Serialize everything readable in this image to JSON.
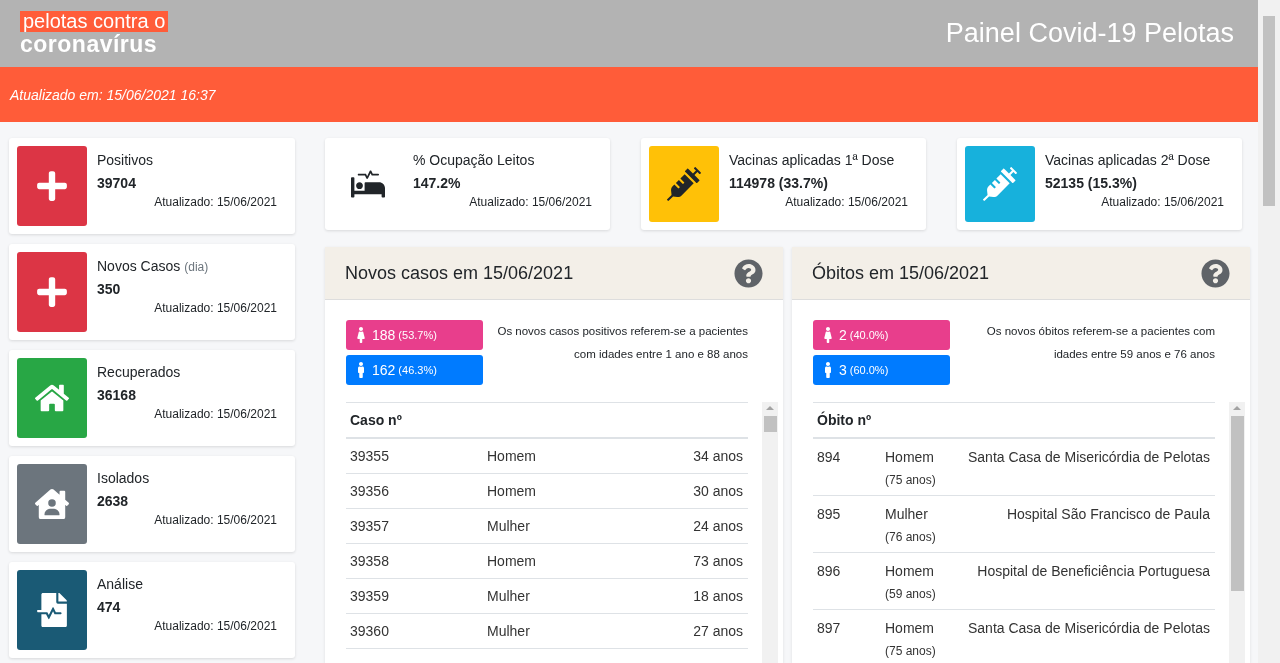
{
  "header": {
    "logo_top": "pelotas contra o",
    "logo_bottom": "coronavírus",
    "title": "Painel Covid-19 Pelotas"
  },
  "update_bar": "Atualizado em: 15/06/2021 16:37",
  "side_cards": [
    {
      "kind": "plus",
      "color": "#dc3545",
      "title": "Positivos",
      "value": "39704",
      "updated": "Atualizado: 15/06/2021"
    },
    {
      "kind": "plus",
      "color": "#dc3545",
      "title": "Novos Casos",
      "note": "(dia)",
      "value": "350",
      "updated": "Atualizado: 15/06/2021"
    },
    {
      "kind": "house",
      "color": "#28a745",
      "title": "Recuperados",
      "value": "36168",
      "updated": "Atualizado: 15/06/2021"
    },
    {
      "kind": "person",
      "color": "#6c757d",
      "title": "Isolados",
      "value": "2638",
      "updated": "Atualizado: 15/06/2021"
    },
    {
      "kind": "document",
      "color": "#1a5a75",
      "title": "Análise",
      "value": "474",
      "updated": "Atualizado: 15/06/2021"
    }
  ],
  "top_cards": [
    {
      "kind": "bed",
      "title": "% Ocupação Leitos",
      "value": "147.2%",
      "updated": "Atualizado: 15/06/2021"
    },
    {
      "kind": "syringe",
      "color": "#ffc107",
      "title": "Vacinas aplicadas 1ª Dose",
      "value": "114978 (33.7%)",
      "updated": "Atualizado: 15/06/2021"
    },
    {
      "kind": "syringe",
      "color": "#17b1dc",
      "title": "Vacinas aplicadas 2ª Dose",
      "value": "52135 (15.3%)",
      "updated": "Atualizado: 15/06/2021"
    }
  ],
  "panels": [
    {
      "kind": "cases",
      "title": "Novos casos em 15/06/2021",
      "female": {
        "count": "188",
        "share": "(53.7%)"
      },
      "male": {
        "count": "162",
        "share": "(46.3%)"
      },
      "description": "Os novos casos positivos referem-se a pacientes com idades entre 1 ano e 88 anos",
      "columns": [
        "Caso nº"
      ],
      "rows": [
        {
          "number": "39355",
          "sex": "Homem",
          "age": "34 anos"
        },
        {
          "number": "39356",
          "sex": "Homem",
          "age": "30 anos"
        },
        {
          "number": "39357",
          "sex": "Mulher",
          "age": "24 anos"
        },
        {
          "number": "39358",
          "sex": "Homem",
          "age": "73 anos"
        },
        {
          "number": "39359",
          "sex": "Mulher",
          "age": "18 anos"
        },
        {
          "number": "39360",
          "sex": "Mulher",
          "age": "27 anos"
        }
      ]
    },
    {
      "kind": "deaths",
      "title": "Óbitos em 15/06/2021",
      "female": {
        "count": "2",
        "share": "(40.0%)"
      },
      "male": {
        "count": "3",
        "share": "(60.0%)"
      },
      "description": "Os novos óbitos referem-se a pacientes com idades entre 59 anos e 76 anos",
      "columns": [
        "Óbito nº"
      ],
      "rows": [
        {
          "number": "894",
          "sex": "Homem",
          "age": "(75 anos)",
          "hospital": "Santa Casa de Misericórdia de Pelotas"
        },
        {
          "number": "895",
          "sex": "Mulher",
          "age": "(76 anos)",
          "hospital": "Hospital São Francisco de Paula"
        },
        {
          "number": "896",
          "sex": "Homem",
          "age": "(59 anos)",
          "hospital": "Hospital de Beneficiência Portuguesa"
        },
        {
          "number": "897",
          "sex": "Homem",
          "age": "(75 anos)",
          "hospital": "Santa Casa de Misericórdia de Pelotas"
        }
      ]
    }
  ]
}
